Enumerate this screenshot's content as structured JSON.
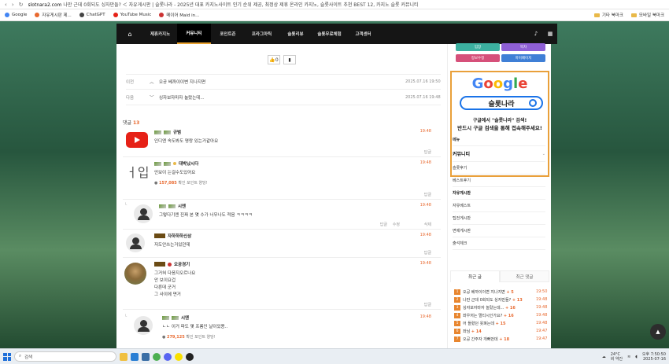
{
  "browser": {
    "address": "slotnara2.com",
    "page_title": "나만 근데 0회되도 싱자만들? ＜ 자유게시판 | 슬롯나라 - 2025년 대표 카지노사이트 인기 순위 제공, 최정상 제휴 온라인 카지노, 슬롯사이트 추천 BEST 12, 카지노 슬롯 커뮤니티",
    "bookmarks": [
      "Google",
      "자유게시판 제...",
      "ChatGPT",
      "YouTube Music",
      "메이어 Maid in..."
    ],
    "bookmark_folders": [
      "기타 북마크",
      "모바일 북마크"
    ]
  },
  "nav": {
    "items": [
      "제휴카지노",
      "커뮤니티",
      "포인트존",
      "프라그마틱",
      "슬롯리뷰",
      "슬롯무료체험",
      "고객센터"
    ],
    "active_index": 1
  },
  "post": {
    "likes": "0",
    "prev_label": "이전",
    "prev_title": "오공 베까이이변 지나지면",
    "prev_date": "2025.07.16 19:50",
    "next_label": "다음",
    "next_title": "싱자보자마자 놀랐는데...",
    "next_date": "2025.07.16 19:48"
  },
  "comments_header": {
    "label": "댓글",
    "count": "13"
  },
  "comments": [
    {
      "name": "규범",
      "text": "인디엔 속도봐도 명랑 있는거같아요",
      "time": "19:48",
      "reply": "답글"
    },
    {
      "name": "대박났시다",
      "text": "안보이 는걸수도있어요",
      "points": "157,085",
      "points_suffix": "확인 포인트 양당!",
      "time": "19:48",
      "reply": "답글"
    },
    {
      "name": "시엔",
      "text": "그렇다기엔 진짜 본 몇 수가 너무나도 적음 ㅋㅋㅋㅋ",
      "time": "19:48",
      "reply": "답글",
      "edit": "수정",
      "delete": "삭제"
    },
    {
      "name": "자하하하신상",
      "text": "저도안쓰는거있던데",
      "time": "19:48",
      "reply": "답글"
    },
    {
      "name": "오공경기",
      "lines": [
        "그거혀 다음지오르나요",
        "안 보이요겁",
        "다른데 군거",
        "그 사이에 면거"
      ],
      "time": "19:48",
      "reply": "답글"
    },
    {
      "name": "시엔",
      "text": "ㄴㄴ 이거 파도 몇 프롬인 날이있용..",
      "points": "279,125",
      "points_suffix": "확인 포인트 양당!",
      "time": "19:48"
    }
  ],
  "sidebar": {
    "buttons": [
      {
        "label": "입장",
        "color": "#3cb0a0"
      },
      {
        "label": "목차",
        "color": "#8f5fd6"
      },
      {
        "label": "정보수정",
        "color": "#d6507a"
      },
      {
        "label": "마이페이지",
        "color": "#3f7fd6"
      }
    ],
    "google_logo": "Google",
    "search_text": "슬롯나라",
    "promo_line1": "구글에서 \"슬롯나라\" 검색!",
    "promo_line2": "반드시 구글 검색을 통해 접속해주세요!",
    "menu_header": "메뉴",
    "community_header": "커뮤니티",
    "community_items": [
      "슬롯후기",
      "베스트후기",
      "자유게시판",
      "자유베스트",
      "팁전게시판",
      "면제게시판",
      "출석체크"
    ],
    "tabs": [
      "최근 글",
      "최근 댓글"
    ],
    "recent": [
      {
        "n": "1",
        "title": "오공 베까이이변 지나지면",
        "count": "+ 5",
        "time": "19:50"
      },
      {
        "n": "2",
        "title": "나만 근데 0회되도 싱자만들?",
        "count": "+ 13",
        "time": "19:48"
      },
      {
        "n": "3",
        "title": "싱자보자마자 놀랐는데...",
        "count": "+ 16",
        "time": "19:48"
      },
      {
        "n": "4",
        "title": "좌우저는 멀티시인가요?",
        "count": "+ 16",
        "time": "19:48"
      },
      {
        "n": "5",
        "title": "어 들렸던 옷펴는데",
        "count": "+ 15",
        "time": "19:48"
      },
      {
        "n": "6",
        "title": "좌님",
        "count": "+ 14",
        "time": "19:47"
      },
      {
        "n": "7",
        "title": "오공 간주자 개뻐먼데",
        "count": "+ 18",
        "time": "19:47"
      }
    ]
  },
  "taskbar": {
    "search_placeholder": "검색",
    "weather": "24°C",
    "weather_sub": "비 약간",
    "time": "오후 7:50:50",
    "date": "2025-07-16"
  }
}
